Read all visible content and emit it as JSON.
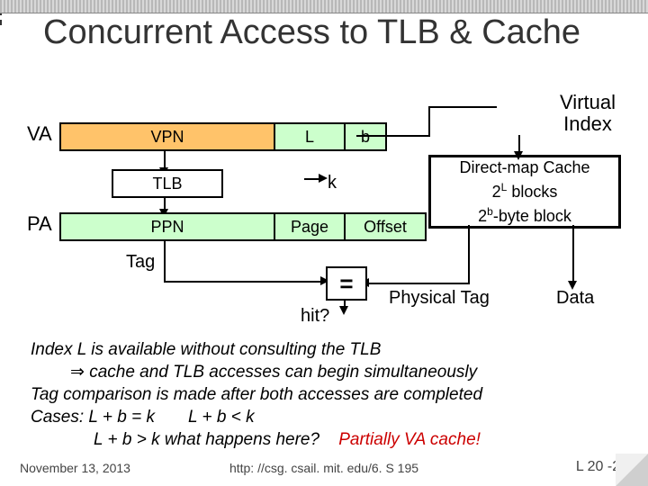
{
  "title": "Concurrent Access to TLB & Cache",
  "virtual_index": "Virtual\nIndex",
  "va": {
    "label": "VA",
    "vpn": "VPN",
    "L": "L",
    "b": "b"
  },
  "tlb": "TLB",
  "k": "k",
  "pa": {
    "label": "PA",
    "ppn": "PPN",
    "page": "Page",
    "offset": "Offset"
  },
  "tag": "Tag",
  "cache": {
    "line1": "Direct-map Cache",
    "line2_pre": "2",
    "line2_sup": "L",
    "line2_post": " blocks",
    "line3_pre": "2",
    "line3_sup": "b",
    "line3_post": "-byte block"
  },
  "eq": "=",
  "hit": "hit?",
  "ptag": "Physical Tag",
  "data": "Data",
  "body": {
    "l1": "Index L is available without consulting the TLB",
    "l2": " cache and TLB accesses can begin simultaneously",
    "l3": "Tag comparison is made after both accesses are completed",
    "l4a": "Cases:  L + b = k",
    "l4b": "L + b < k",
    "l5a": "L + b > k  what happens here?",
    "l5b": "Partially VA cache!"
  },
  "footer": {
    "date": "November 13, 2013",
    "url": "http: //csg. csail. mit. edu/6. S 195",
    "page": "L 20 -24"
  }
}
